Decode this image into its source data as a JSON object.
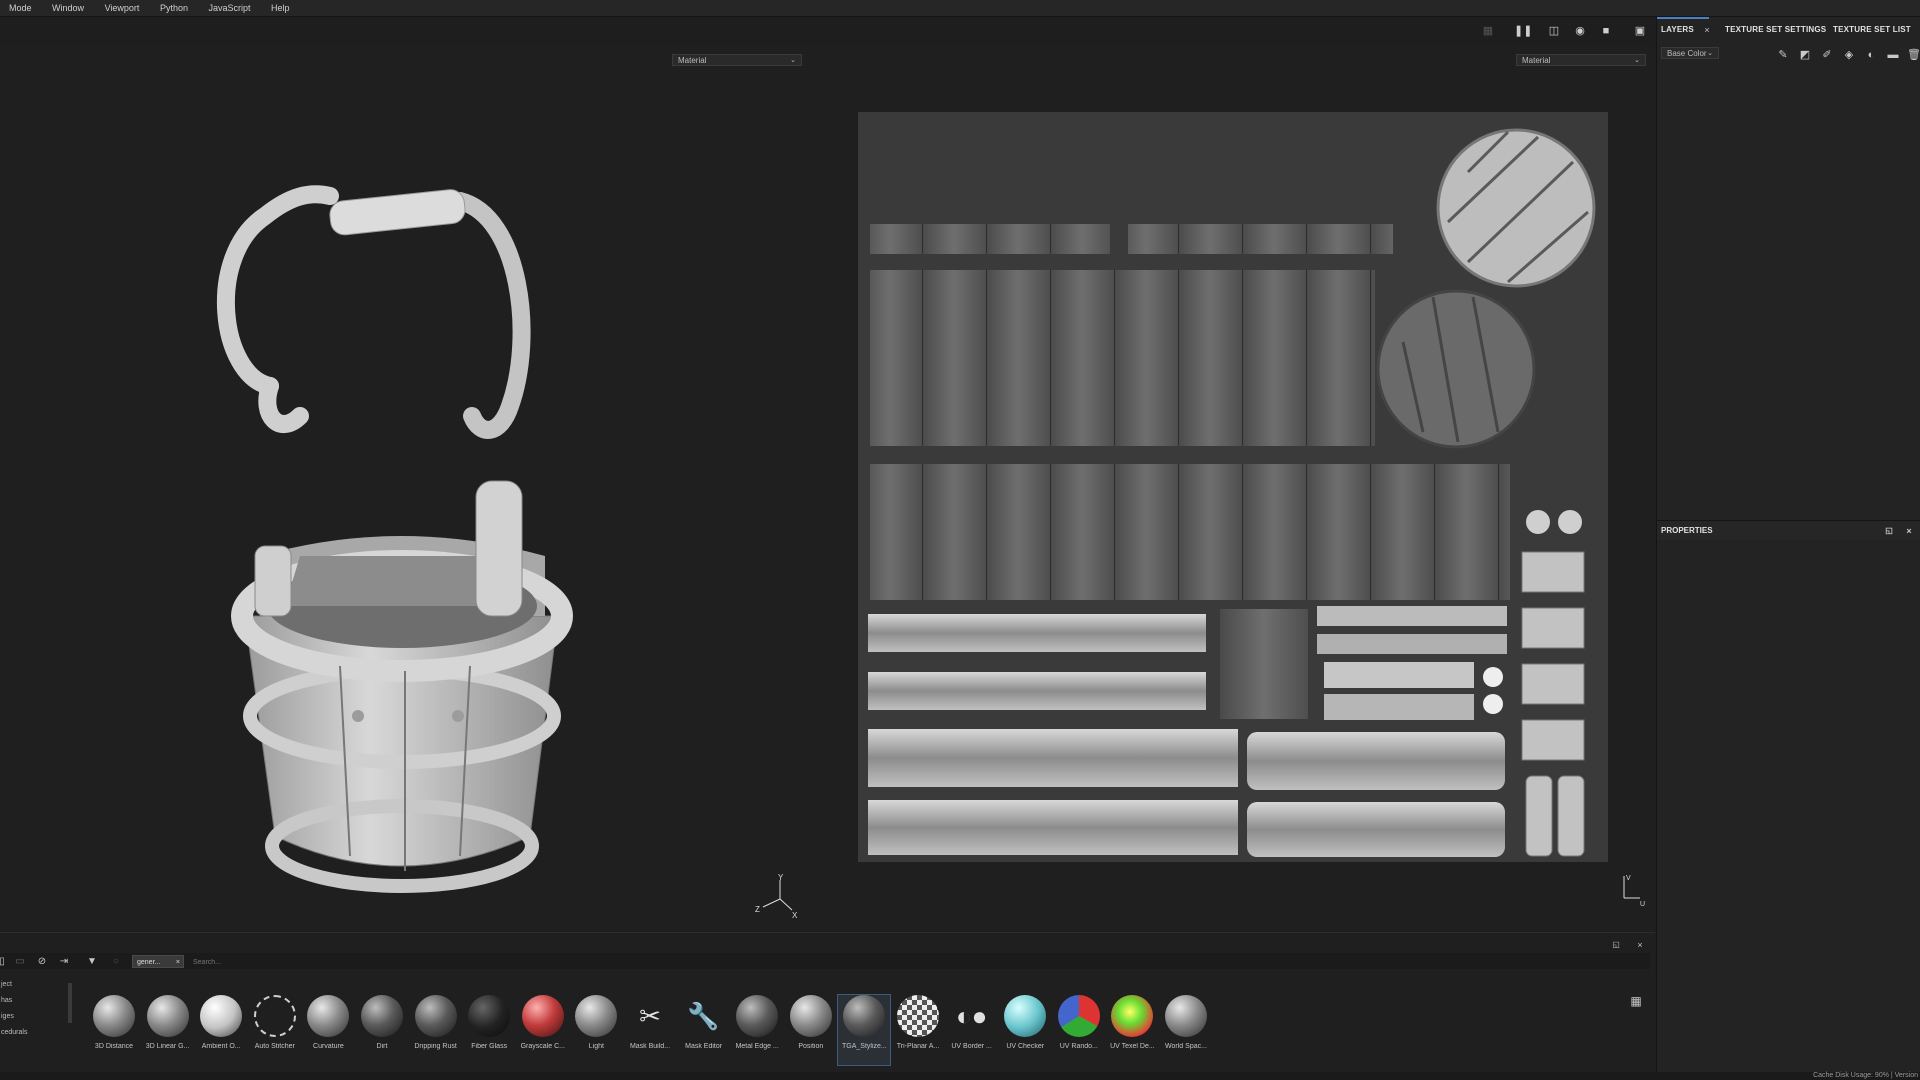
{
  "menu": [
    "Mode",
    "Window",
    "Viewport",
    "Python",
    "JavaScript",
    "Help"
  ],
  "viewport": {
    "left_dropdown": "Material",
    "right_dropdown": "Material",
    "axis_left": {
      "x": "X",
      "y": "Y",
      "z": "Z"
    },
    "axis_right": {
      "u": "U",
      "v": "V"
    }
  },
  "panel": {
    "tabs": [
      "LAYERS",
      "TEXTURE SET SETTINGS",
      "TEXTURE SET LIST"
    ],
    "channel_dropdown": "Base Color",
    "properties_title": "PROPERTIES"
  },
  "shelf": {
    "search_tag": "gener...",
    "search_placeholder": "Search...",
    "categories": [
      "ject",
      "has",
      "iges",
      "cedurals"
    ],
    "items": [
      {
        "label": "3D Distance",
        "style": "gray"
      },
      {
        "label": "3D Linear G...",
        "style": "gray"
      },
      {
        "label": "Ambient O...",
        "style": "white"
      },
      {
        "label": "Auto Stitcher",
        "style": "ring"
      },
      {
        "label": "Curvature",
        "style": "gray"
      },
      {
        "label": "Dirt",
        "style": "dark"
      },
      {
        "label": "Dripping Rust",
        "style": "dark"
      },
      {
        "label": "Fiber Glass",
        "style": "black"
      },
      {
        "label": "Grayscale C...",
        "style": "red"
      },
      {
        "label": "Light",
        "style": "gray"
      },
      {
        "label": "Mask Build...",
        "style": "tools"
      },
      {
        "label": "Mask Editor",
        "style": "wrench"
      },
      {
        "label": "Metal Edge ...",
        "style": "dark"
      },
      {
        "label": "Position",
        "style": "gray"
      },
      {
        "label": "TGA_Stylize...",
        "style": "dark"
      },
      {
        "label": "Tri-Planar A...",
        "style": "checker"
      },
      {
        "label": "UV Border ...",
        "style": "uvborder"
      },
      {
        "label": "UV Checker",
        "style": "teal"
      },
      {
        "label": "UV Rando...",
        "style": "rgb"
      },
      {
        "label": "UV Texel De...",
        "style": "rainbow"
      },
      {
        "label": "World Spac...",
        "style": "gray"
      }
    ],
    "selected_index": 14
  },
  "status": "Cache Disk Usage: 90% | Version"
}
